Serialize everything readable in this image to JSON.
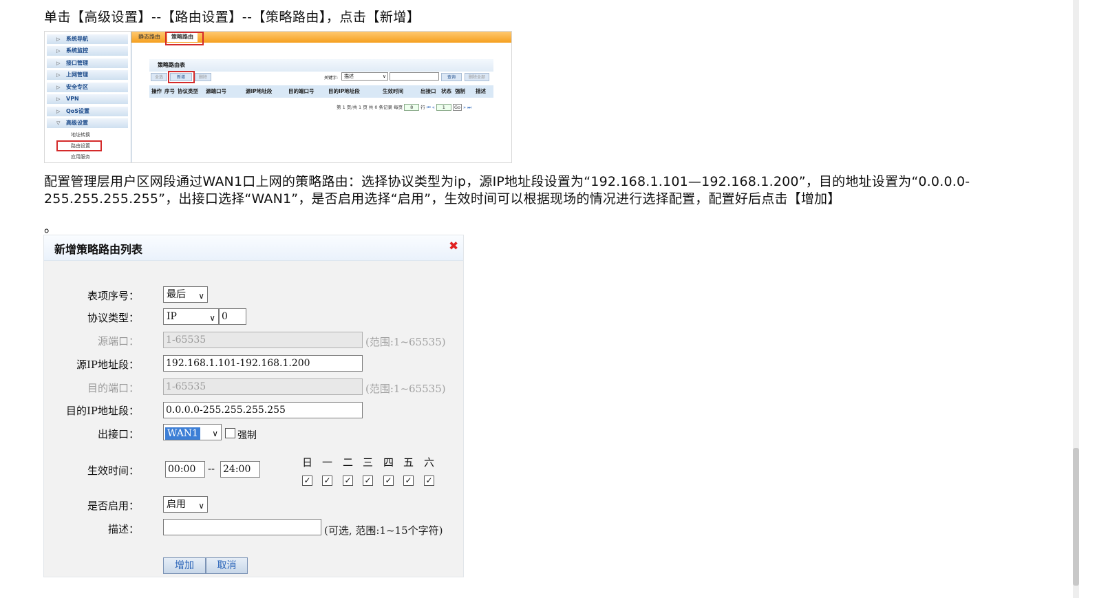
{
  "intro": "单击【高级设置】--【路由设置】--【策略路由】，点击【新增】",
  "shot1": {
    "sidebar": [
      "系统导航",
      "系统监控",
      "接口管理",
      "上网管理",
      "安全专区",
      "VPN",
      "QoS设置",
      "高级设置"
    ],
    "sub_items": [
      "地址转换",
      "路由设置",
      "应用服务"
    ],
    "tabs": [
      "静态路由",
      "策略路由"
    ],
    "panel_title": "策略路由表",
    "buttons": [
      "全选",
      "新增",
      "删除"
    ],
    "search_label": "关键字:",
    "search_select": "描述",
    "query_btn": "查询",
    "delete_all_btn": "删除全部",
    "columns": [
      "操作",
      "序号",
      "协议类型",
      "源端口号",
      "源IP地址段",
      "目的端口号",
      "目的IP地址段",
      "生效时间",
      "出接口",
      "状态",
      "强制",
      "描述"
    ],
    "pager_text": "第 1 页/共 1 页 共 0 条记录 每页",
    "per_page": "8",
    "row_label": "行",
    "page_num": "1",
    "go": "Go"
  },
  "paragraph": "配置管理层用户区网段通过WAN1口上网的策略路由：选择协议类型为ip，源IP地址段设置为“192.168.1.101—192.168.1.200”，目的地址设置为“0.0.0.0-255.255.255.255”，出接口选择“WAN1”，是否启用选择“启用”，生效时间可以根据现场的情况进行选择配置，配置好后点击【增加】",
  "period": "。",
  "dialog": {
    "title": "新增策略路由列表",
    "close_icon": "✖",
    "labels": {
      "index": "表项序号：",
      "protocol": "协议类型：",
      "src_port": "源端口：",
      "src_ip": "源IP地址段：",
      "dst_port": "目的端口：",
      "dst_ip": "目的IP地址段：",
      "out_if": "出接口：",
      "time": "生效时间：",
      "enable": "是否启用：",
      "desc": "描述："
    },
    "index_value": "最后",
    "protocol_value": "IP",
    "protocol_num": "0",
    "src_port_placeholder": "1-65535",
    "src_port_hint": "(范围:1~65535)",
    "src_ip_value": "192.168.1.101-192.168.1.200",
    "dst_port_placeholder": "1-65535",
    "dst_port_hint": "(范围:1~65535)",
    "dst_ip_value": "0.0.0.0-255.255.255.255",
    "out_if_value": "WAN1",
    "force_label": "强制",
    "time_start": "00:00",
    "time_sep": "--",
    "time_end": "24:00",
    "days": [
      "日",
      "一",
      "二",
      "三",
      "四",
      "五",
      "六"
    ],
    "check_mark": "✓",
    "enable_value": "启用",
    "desc_hint": "(可选, 范围:1~15个字符)",
    "add_btn": "增加",
    "cancel_btn": "取消"
  }
}
